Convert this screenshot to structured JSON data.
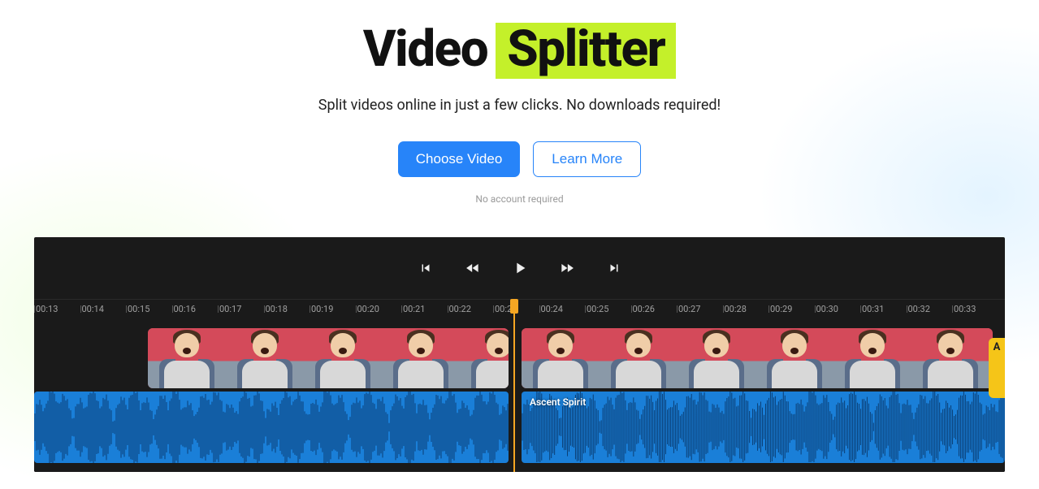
{
  "hero": {
    "title_word1": "Video",
    "title_word2": "Splitter",
    "subtitle": "Split videos online in just a few clicks. No downloads required!",
    "primary_cta": "Choose Video",
    "secondary_cta": "Learn More",
    "note": "No account required"
  },
  "ruler": {
    "ticks": [
      "00:13",
      "00:14",
      "00:15",
      "00:16",
      "00:17",
      "00:18",
      "00:19",
      "00:20",
      "00:21",
      "00:22",
      "00:23",
      "00:24",
      "00:25",
      "00:26",
      "00:27",
      "00:28",
      "00:29",
      "00:30",
      "00:31",
      "00:32",
      "00:33"
    ]
  },
  "timeline": {
    "audio_label": "Ascent Spirit",
    "end_marker": "A"
  }
}
